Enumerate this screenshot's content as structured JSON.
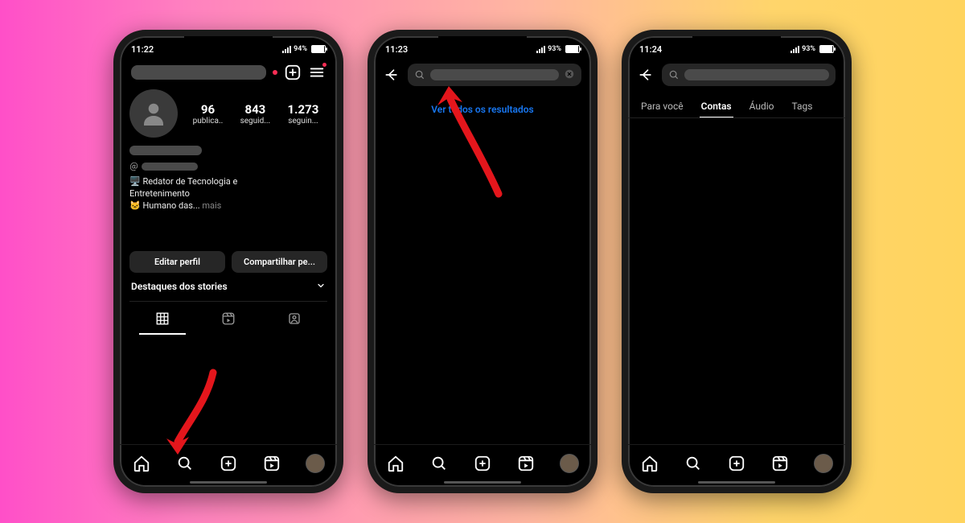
{
  "phones": [
    {
      "status": {
        "time": "11:22",
        "battery_pct": "94%"
      },
      "profile": {
        "stats": [
          {
            "count": "96",
            "label": "publica.."
          },
          {
            "count": "843",
            "label": "seguid..."
          },
          {
            "count": "1.273",
            "label": "seguin..."
          }
        ],
        "bio_line1_emoji": "🖥️",
        "bio_line1": "Redator de Tecnologia e",
        "bio_line2": "Entretenimento",
        "bio_line3_emoji": "🐱",
        "bio_line3_prefix": "Humano das...",
        "bio_more": "mais",
        "edit_label": "Editar perfil",
        "share_label": "Compartilhar pe...",
        "highlights_label": "Destaques dos stories"
      }
    },
    {
      "status": {
        "time": "11:23",
        "battery_pct": "93%"
      },
      "search": {
        "results_link": "Ver todos os resultados"
      }
    },
    {
      "status": {
        "time": "11:24",
        "battery_pct": "93%"
      },
      "search_tabs": [
        "Para você",
        "Contas",
        "Áudio",
        "Tags"
      ],
      "search_tabs_active": 1
    }
  ]
}
